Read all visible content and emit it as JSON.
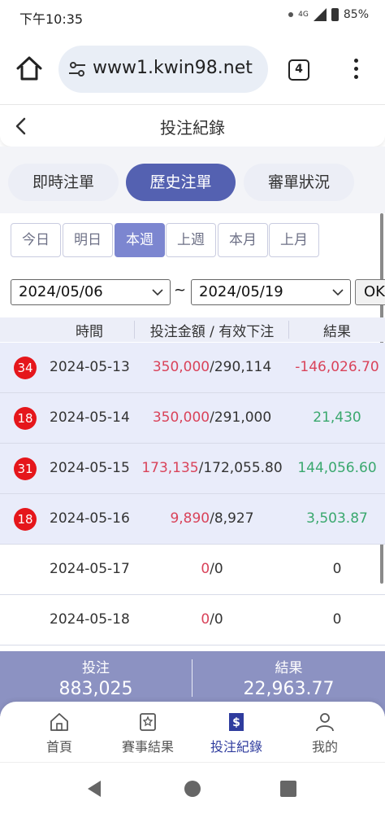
{
  "status_bar": {
    "time": "下午10:35",
    "network": "4G",
    "battery": "85%"
  },
  "browser": {
    "url": "www1.kwin98.net",
    "tab_count": "4"
  },
  "header": {
    "title": "投注紀錄"
  },
  "segments": [
    {
      "label": "即時注單",
      "active": false
    },
    {
      "label": "歷史注單",
      "active": true
    },
    {
      "label": "審單狀況",
      "active": false
    }
  ],
  "periods": [
    {
      "label": "今日",
      "active": false
    },
    {
      "label": "明日",
      "active": false
    },
    {
      "label": "本週",
      "active": true
    },
    {
      "label": "上週",
      "active": false
    },
    {
      "label": "本月",
      "active": false
    },
    {
      "label": "上月",
      "active": false
    }
  ],
  "date_filter": {
    "start": "2024/05/06",
    "separator": "~",
    "end": "2024/05/19",
    "ok_label": "OK"
  },
  "table": {
    "headers": {
      "time": "時間",
      "amount": "投注金額 / 有效下注",
      "result": "結果"
    },
    "rows": [
      {
        "count": "34",
        "date": "2024-05-13",
        "bet": "350,000",
        "valid": "/290,114",
        "result": "-146,026.70",
        "tone": "neg",
        "highlight": true
      },
      {
        "count": "18",
        "date": "2024-05-14",
        "bet": "350,000",
        "valid": "/291,000",
        "result": "21,430",
        "tone": "pos",
        "highlight": true
      },
      {
        "count": "31",
        "date": "2024-05-15",
        "bet": "173,135",
        "valid": "/172,055.80",
        "result": "144,056.60",
        "tone": "pos",
        "highlight": true
      },
      {
        "count": "18",
        "date": "2024-05-16",
        "bet": "9,890",
        "valid": "/8,927",
        "result": "3,503.87",
        "tone": "pos",
        "highlight": true
      },
      {
        "count": "",
        "date": "2024-05-17",
        "bet": "0",
        "valid": "/0",
        "result": "0",
        "tone": "zero",
        "highlight": false
      },
      {
        "count": "",
        "date": "2024-05-18",
        "bet": "0",
        "valid": "/0",
        "result": "0",
        "tone": "zero",
        "highlight": false
      }
    ]
  },
  "summary": {
    "bet_label": "投注",
    "bet_total": "883,025",
    "result_label": "結果",
    "result_total": "22,963.77"
  },
  "bottom_nav": [
    {
      "label": "首頁",
      "icon": "home-icon",
      "active": false
    },
    {
      "label": "賽事結果",
      "icon": "scoreboard-icon",
      "active": false
    },
    {
      "label": "投注紀錄",
      "icon": "bet-record-icon",
      "active": true
    },
    {
      "label": "我的",
      "icon": "user-icon",
      "active": false
    }
  ],
  "colors": {
    "accent": "#5461b1",
    "negative": "#d9435a",
    "positive": "#3aa86e",
    "badge": "#e5161b",
    "summary_bg": "#8c92c2"
  }
}
